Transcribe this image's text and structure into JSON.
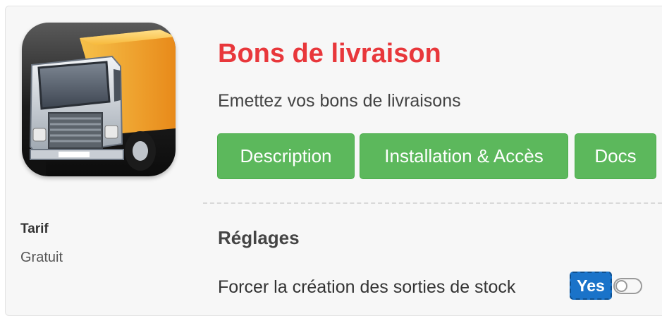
{
  "module": {
    "icon": "delivery-truck-icon",
    "title": "Bons de livraison",
    "subtitle": "Emettez vos bons de livraisons"
  },
  "buttons": {
    "description": "Description",
    "installation": "Installation & Accès",
    "docs": "Docs"
  },
  "pricing": {
    "label": "Tarif",
    "value": "Gratuit"
  },
  "settings": {
    "heading": "Réglages",
    "items": [
      {
        "label": "Forcer la création des sorties de stock",
        "toggle_label": "Yes",
        "enabled": true
      }
    ]
  },
  "colors": {
    "title": "#e8373b",
    "button": "#5cb85c",
    "toggle_active": "#1a73c9"
  }
}
